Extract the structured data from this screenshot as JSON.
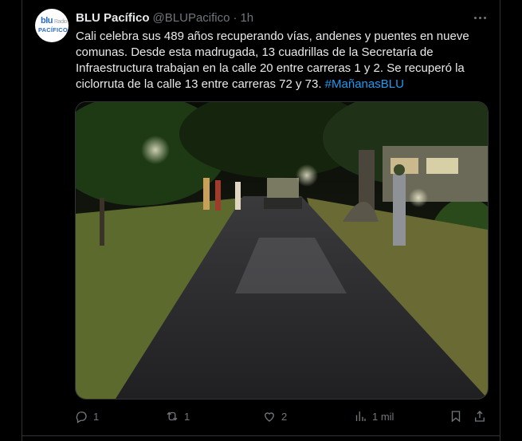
{
  "tweet": {
    "display_name": "BLU Pacífico",
    "handle": "@BLUPacifico",
    "separator": "·",
    "time": "1h",
    "avatar": {
      "brand": "blu",
      "brand_small": "Radio",
      "sub": "PACÍFICO"
    },
    "text_main": "Cali celebra sus 489 años recuperando vías, andenes y puentes en nueve comunas. Desde esta madrugada, 13 cuadrillas de la Secretaría de Infraestructura trabajan en la calle 20 entre carreras 1 y 2. Se recuperó la ciclorruta de la calle 13 entre carreras 72 y 73.",
    "hashtag": "#MañanasBLU",
    "media_description_icon": "photo"
  },
  "actions": {
    "reply_count": "1",
    "retweet_count": "1",
    "like_count": "2",
    "views_count": "1 mil"
  },
  "icons": {
    "more": "more-icon",
    "reply": "reply-icon",
    "retweet": "retweet-icon",
    "like": "like-icon",
    "views": "views-icon",
    "bookmark": "bookmark-icon",
    "share": "share-icon"
  },
  "colors": {
    "background": "#000000",
    "text": "#e7e9ea",
    "muted": "#71767b",
    "link": "#1d9bf0",
    "border": "#2f3336"
  }
}
